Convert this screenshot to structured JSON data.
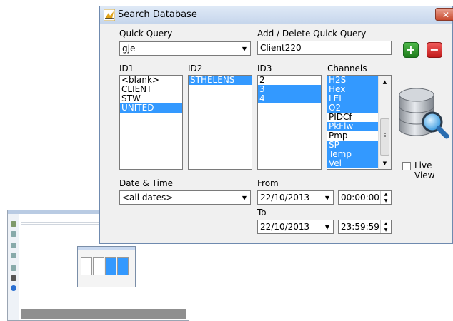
{
  "dialog": {
    "title": "Search Database",
    "close_symbol": "✕"
  },
  "quick_query": {
    "label": "Quick Query",
    "value": "gje"
  },
  "add_delete": {
    "label": "Add / Delete Quick Query",
    "value": "Client220"
  },
  "lists": {
    "id1": {
      "label": "ID1",
      "items": [
        {
          "text": "<blank>",
          "selected": false
        },
        {
          "text": "CLIENT",
          "selected": false
        },
        {
          "text": "STW",
          "selected": false
        },
        {
          "text": "UNITED",
          "selected": true
        }
      ]
    },
    "id2": {
      "label": "ID2",
      "items": [
        {
          "text": "STHELENS",
          "selected": true
        }
      ]
    },
    "id3": {
      "label": "ID3",
      "items": [
        {
          "text": "2",
          "selected": false
        },
        {
          "text": "3",
          "selected": true
        },
        {
          "text": "4",
          "selected": true
        }
      ]
    },
    "channels": {
      "label": "Channels",
      "items": [
        {
          "text": "H2S",
          "selected": true
        },
        {
          "text": "Hex",
          "selected": true
        },
        {
          "text": "LEL",
          "selected": true
        },
        {
          "text": "O2",
          "selected": true
        },
        {
          "text": "PIDCf",
          "selected": false
        },
        {
          "text": "PkFlw",
          "selected": true
        },
        {
          "text": "Pmp",
          "selected": false
        },
        {
          "text": "SP",
          "selected": true
        },
        {
          "text": "Temp",
          "selected": true
        },
        {
          "text": "Vel",
          "selected": true
        }
      ]
    }
  },
  "datetime": {
    "label": "Date & Time",
    "value": "<all dates>"
  },
  "from": {
    "label": "From",
    "date": "22/10/2013",
    "time": "00:00:00"
  },
  "to": {
    "label": "To",
    "date": "22/10/2013",
    "time": "23:59:59"
  },
  "live_view": {
    "label": "Live View",
    "checked": false
  },
  "icons": {
    "add": "plus-icon",
    "delete": "minus-icon",
    "database": "database-search-icon"
  },
  "colors": {
    "selection": "#3399ff",
    "add_button": "#2e9a2a",
    "delete_button": "#d42424"
  }
}
